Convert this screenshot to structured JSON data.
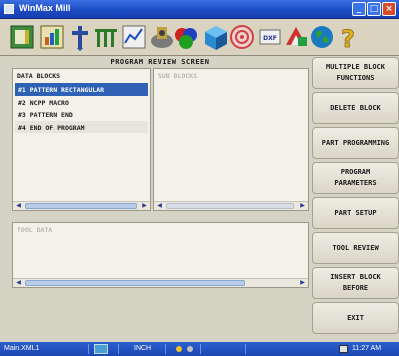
{
  "window": {
    "title": "WinMax Mill"
  },
  "screen": {
    "title": "PROGRAM REVIEW SCREEN"
  },
  "toolbar": {
    "icons": [
      "file-icon",
      "chart-icon",
      "tool-icon",
      "multi-tool-icon",
      "graph-icon",
      "mixer-icon",
      "paint-icon",
      "cube-icon",
      "target-icon",
      "dxf-icon",
      "cad-icon",
      "globe-icon",
      "help-icon"
    ],
    "dxf_label": "DXF"
  },
  "data_blocks": {
    "header": "DATA BLOCKS",
    "items": [
      {
        "label": "#1 PATTERN RECTANGULAR",
        "selected": true
      },
      {
        "label": "#2 NCPP MACRO",
        "selected": false
      },
      {
        "label": "#3 PATTERN END",
        "selected": false
      },
      {
        "label": "#4 END OF PROGRAM",
        "selected": false
      }
    ]
  },
  "sub_blocks": {
    "header": "SUB BLOCKS"
  },
  "tool_data": {
    "header": "TOOL DATA"
  },
  "buttons": [
    "MULTIPLE BLOCK\nFUNCTIONS",
    "DELETE BLOCK",
    "PART PROGRAMMING",
    "PROGRAM\nPARAMETERS",
    "PART SETUP",
    "TOOL REVIEW",
    "INSERT BLOCK\nBEFORE",
    "EXIT"
  ],
  "status": {
    "file": "Main.XML1",
    "units": "INCH",
    "time": "11:27 AM"
  },
  "colors": {
    "selection": "#2f62b4",
    "titlebar": "#1d4cc4",
    "panel_bg": "#d5d3c3"
  }
}
